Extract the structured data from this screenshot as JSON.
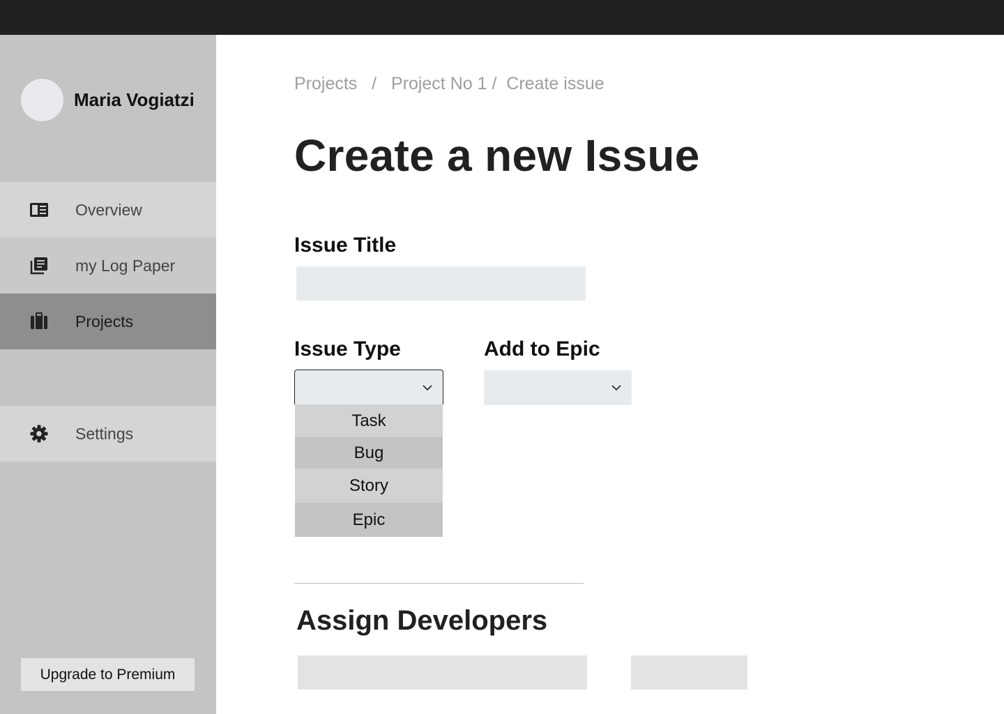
{
  "user": {
    "name": "Maria Vogiatzi"
  },
  "sidebar": {
    "items": [
      {
        "label": "Overview",
        "icon": "newspaper-icon"
      },
      {
        "label": "my Log Paper",
        "icon": "library-books-icon"
      },
      {
        "label": "Projects",
        "icon": "briefcase-icon",
        "active": true
      },
      {
        "label": "Settings",
        "icon": "gear-icon"
      }
    ],
    "upgrade_label": "Upgrade to Premium"
  },
  "breadcrumb": {
    "items": [
      "Projects",
      "Project No 1",
      "Create issue"
    ]
  },
  "page": {
    "title": "Create a new Issue"
  },
  "form": {
    "issue_title_label": "Issue Title",
    "issue_title_value": "",
    "issue_type_label": "Issue Type",
    "issue_type_options": [
      "Task",
      "Bug",
      "Story",
      "Epic"
    ],
    "epic_label": "Add to Epic"
  },
  "assign": {
    "title": "Assign Developers"
  },
  "colors": {
    "topbar": "#212121",
    "sidebar": "#c4c4c4",
    "active_item": "#8e8e8e",
    "input_bg": "#e8ebee"
  }
}
